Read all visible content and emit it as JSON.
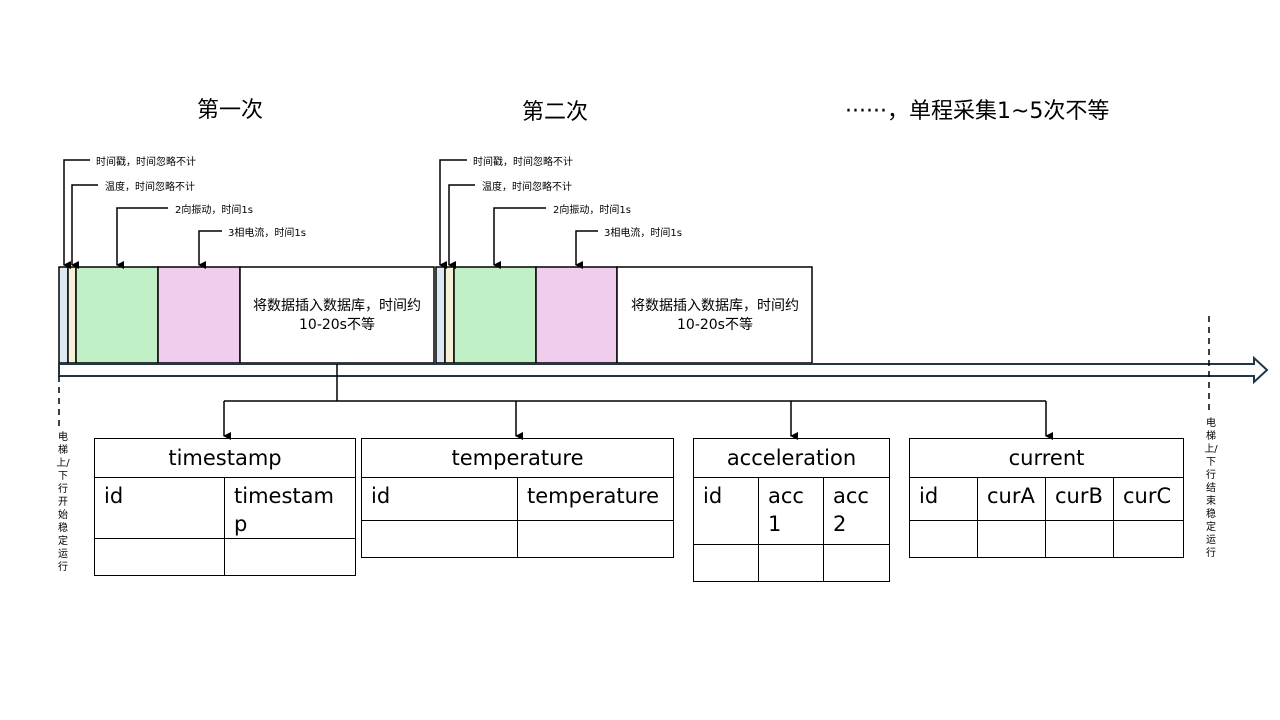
{
  "headings": {
    "first": "第一次",
    "second": "第二次",
    "etc": "······，单程采集1~5次不等"
  },
  "annotations": {
    "timestamp": "时间戳，时间忽略不计",
    "temperature": "温度，时间忽略不计",
    "vibration": "2向振动，时间1s",
    "current": "3相电流，时间1s"
  },
  "insert_note": "将数据插入数据库，时间约10-20s不等",
  "start_label": "电梯上/下行开始稳定运行",
  "end_label": "电梯上/下行结束稳定运行",
  "segment_colors": {
    "timestamp": "#dce9f3",
    "temperature": "#f4f1d8",
    "vibration": "#c1efc6",
    "current": "#f0cdec",
    "insert": "#ffffff"
  },
  "tables": {
    "timestamp": {
      "name": "timestamp",
      "columns": [
        "id",
        "timestamp"
      ]
    },
    "temperature": {
      "name": "temperature",
      "columns": [
        "id",
        "temperature"
      ]
    },
    "acceleration": {
      "name": "acceleration",
      "columns": [
        "id",
        "acc 1",
        "acc 2"
      ]
    },
    "current": {
      "name": "current",
      "columns": [
        "id",
        "curA",
        "curB",
        "curC"
      ]
    }
  }
}
